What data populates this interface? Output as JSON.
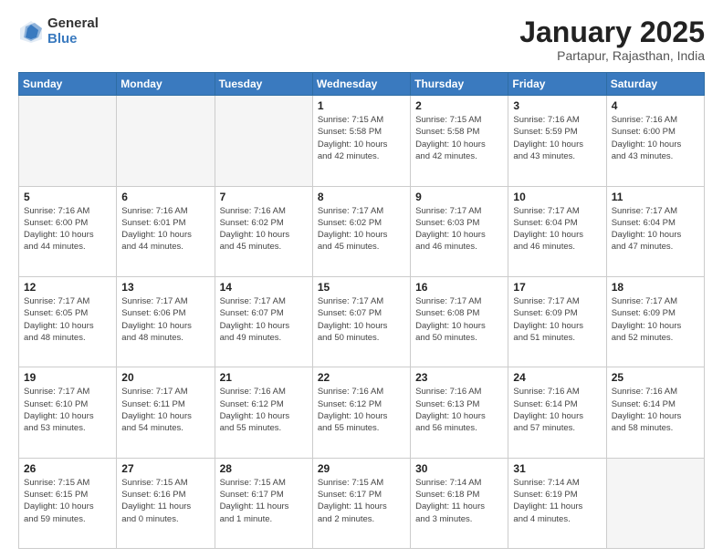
{
  "header": {
    "logo_general": "General",
    "logo_blue": "Blue",
    "title": "January 2025",
    "location": "Partapur, Rajasthan, India"
  },
  "weekdays": [
    "Sunday",
    "Monday",
    "Tuesday",
    "Wednesday",
    "Thursday",
    "Friday",
    "Saturday"
  ],
  "weeks": [
    [
      {
        "day": "",
        "info": ""
      },
      {
        "day": "",
        "info": ""
      },
      {
        "day": "",
        "info": ""
      },
      {
        "day": "1",
        "info": "Sunrise: 7:15 AM\nSunset: 5:58 PM\nDaylight: 10 hours\nand 42 minutes."
      },
      {
        "day": "2",
        "info": "Sunrise: 7:15 AM\nSunset: 5:58 PM\nDaylight: 10 hours\nand 42 minutes."
      },
      {
        "day": "3",
        "info": "Sunrise: 7:16 AM\nSunset: 5:59 PM\nDaylight: 10 hours\nand 43 minutes."
      },
      {
        "day": "4",
        "info": "Sunrise: 7:16 AM\nSunset: 6:00 PM\nDaylight: 10 hours\nand 43 minutes."
      }
    ],
    [
      {
        "day": "5",
        "info": "Sunrise: 7:16 AM\nSunset: 6:00 PM\nDaylight: 10 hours\nand 44 minutes."
      },
      {
        "day": "6",
        "info": "Sunrise: 7:16 AM\nSunset: 6:01 PM\nDaylight: 10 hours\nand 44 minutes."
      },
      {
        "day": "7",
        "info": "Sunrise: 7:16 AM\nSunset: 6:02 PM\nDaylight: 10 hours\nand 45 minutes."
      },
      {
        "day": "8",
        "info": "Sunrise: 7:17 AM\nSunset: 6:02 PM\nDaylight: 10 hours\nand 45 minutes."
      },
      {
        "day": "9",
        "info": "Sunrise: 7:17 AM\nSunset: 6:03 PM\nDaylight: 10 hours\nand 46 minutes."
      },
      {
        "day": "10",
        "info": "Sunrise: 7:17 AM\nSunset: 6:04 PM\nDaylight: 10 hours\nand 46 minutes."
      },
      {
        "day": "11",
        "info": "Sunrise: 7:17 AM\nSunset: 6:04 PM\nDaylight: 10 hours\nand 47 minutes."
      }
    ],
    [
      {
        "day": "12",
        "info": "Sunrise: 7:17 AM\nSunset: 6:05 PM\nDaylight: 10 hours\nand 48 minutes."
      },
      {
        "day": "13",
        "info": "Sunrise: 7:17 AM\nSunset: 6:06 PM\nDaylight: 10 hours\nand 48 minutes."
      },
      {
        "day": "14",
        "info": "Sunrise: 7:17 AM\nSunset: 6:07 PM\nDaylight: 10 hours\nand 49 minutes."
      },
      {
        "day": "15",
        "info": "Sunrise: 7:17 AM\nSunset: 6:07 PM\nDaylight: 10 hours\nand 50 minutes."
      },
      {
        "day": "16",
        "info": "Sunrise: 7:17 AM\nSunset: 6:08 PM\nDaylight: 10 hours\nand 50 minutes."
      },
      {
        "day": "17",
        "info": "Sunrise: 7:17 AM\nSunset: 6:09 PM\nDaylight: 10 hours\nand 51 minutes."
      },
      {
        "day": "18",
        "info": "Sunrise: 7:17 AM\nSunset: 6:09 PM\nDaylight: 10 hours\nand 52 minutes."
      }
    ],
    [
      {
        "day": "19",
        "info": "Sunrise: 7:17 AM\nSunset: 6:10 PM\nDaylight: 10 hours\nand 53 minutes."
      },
      {
        "day": "20",
        "info": "Sunrise: 7:17 AM\nSunset: 6:11 PM\nDaylight: 10 hours\nand 54 minutes."
      },
      {
        "day": "21",
        "info": "Sunrise: 7:16 AM\nSunset: 6:12 PM\nDaylight: 10 hours\nand 55 minutes."
      },
      {
        "day": "22",
        "info": "Sunrise: 7:16 AM\nSunset: 6:12 PM\nDaylight: 10 hours\nand 55 minutes."
      },
      {
        "day": "23",
        "info": "Sunrise: 7:16 AM\nSunset: 6:13 PM\nDaylight: 10 hours\nand 56 minutes."
      },
      {
        "day": "24",
        "info": "Sunrise: 7:16 AM\nSunset: 6:14 PM\nDaylight: 10 hours\nand 57 minutes."
      },
      {
        "day": "25",
        "info": "Sunrise: 7:16 AM\nSunset: 6:14 PM\nDaylight: 10 hours\nand 58 minutes."
      }
    ],
    [
      {
        "day": "26",
        "info": "Sunrise: 7:15 AM\nSunset: 6:15 PM\nDaylight: 10 hours\nand 59 minutes."
      },
      {
        "day": "27",
        "info": "Sunrise: 7:15 AM\nSunset: 6:16 PM\nDaylight: 11 hours\nand 0 minutes."
      },
      {
        "day": "28",
        "info": "Sunrise: 7:15 AM\nSunset: 6:17 PM\nDaylight: 11 hours\nand 1 minute."
      },
      {
        "day": "29",
        "info": "Sunrise: 7:15 AM\nSunset: 6:17 PM\nDaylight: 11 hours\nand 2 minutes."
      },
      {
        "day": "30",
        "info": "Sunrise: 7:14 AM\nSunset: 6:18 PM\nDaylight: 11 hours\nand 3 minutes."
      },
      {
        "day": "31",
        "info": "Sunrise: 7:14 AM\nSunset: 6:19 PM\nDaylight: 11 hours\nand 4 minutes."
      },
      {
        "day": "",
        "info": ""
      }
    ]
  ]
}
